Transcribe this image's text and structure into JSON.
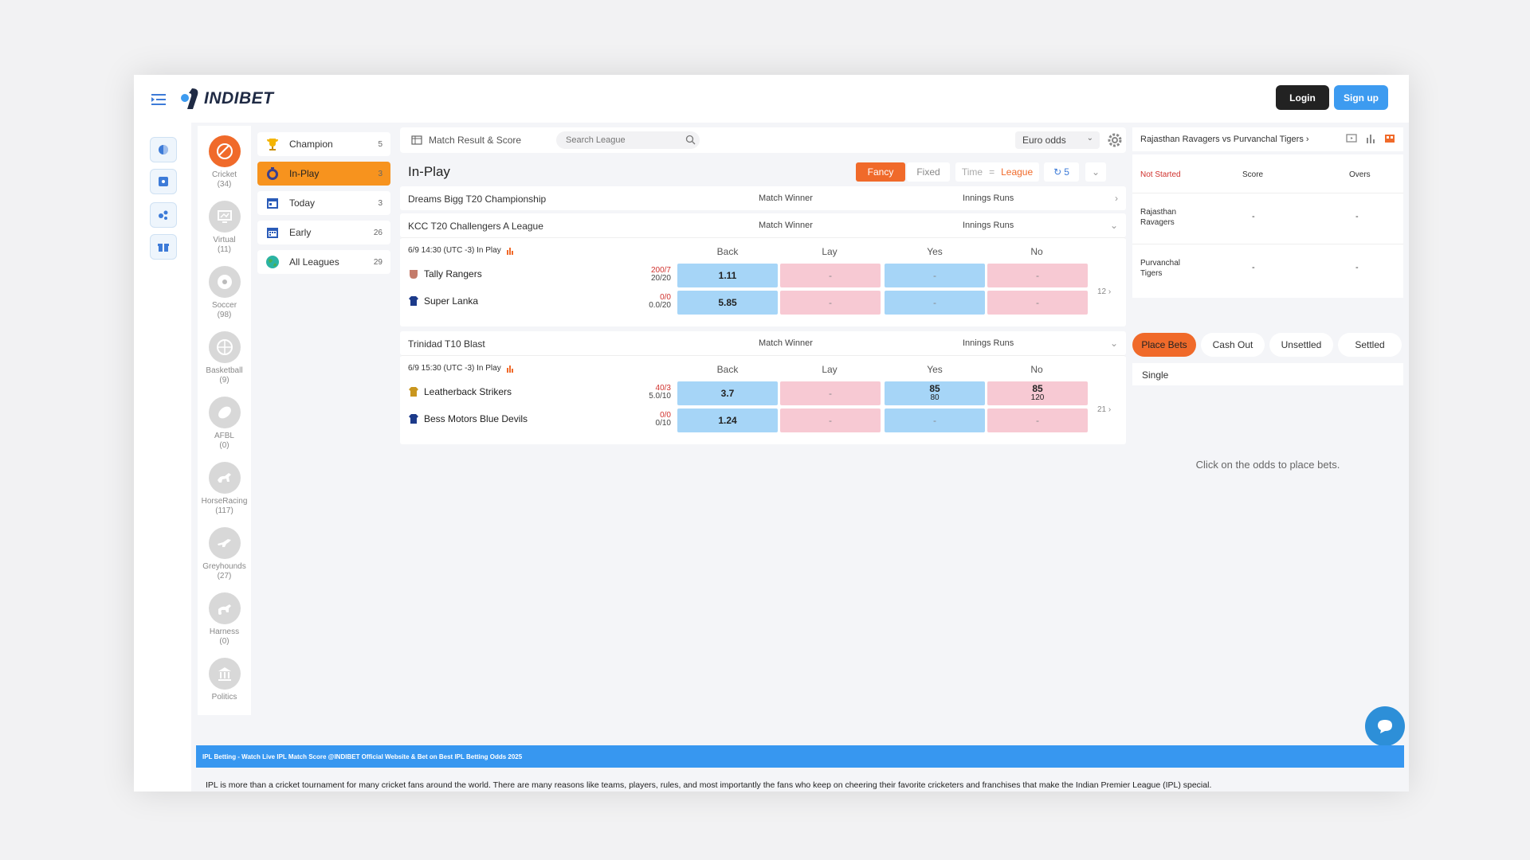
{
  "brand": {
    "name": "INDIBET"
  },
  "header": {
    "login_label": "Login",
    "signup_label": "Sign up"
  },
  "colors": {
    "accent": "#f06a2a",
    "primary": "#3d9bf0",
    "back": "#a6d5f7",
    "lay": "#f7c9d3"
  },
  "sports": [
    {
      "label": "Cricket",
      "count": "(34)",
      "icon": "cricket-ball-icon"
    },
    {
      "label": "Virtual",
      "count": "(11)",
      "icon": "monitor-icon"
    },
    {
      "label": "Soccer",
      "count": "(98)",
      "icon": "soccer-ball-icon"
    },
    {
      "label": "Basketball",
      "count": "(9)",
      "icon": "basketball-icon"
    },
    {
      "label": "AFBL",
      "count": "(0)",
      "icon": "football-icon"
    },
    {
      "label": "HorseRacing",
      "count": "(117)",
      "icon": "horse-icon"
    },
    {
      "label": "Greyhounds",
      "count": "(27)",
      "icon": "greyhound-icon"
    },
    {
      "label": "Harness",
      "count": "(0)",
      "icon": "harness-icon"
    },
    {
      "label": "Politics",
      "count": "",
      "icon": "politics-icon"
    }
  ],
  "categories": [
    {
      "label": "Champion",
      "count": "5",
      "icon": "trophy-icon"
    },
    {
      "label": "In-Play",
      "count": "3",
      "icon": "stopwatch-icon"
    },
    {
      "label": "Today",
      "count": "3",
      "icon": "calendar-today-icon"
    },
    {
      "label": "Early",
      "count": "26",
      "icon": "calendar-icon"
    },
    {
      "label": "All Leagues",
      "count": "29",
      "icon": "globe-icon"
    }
  ],
  "filter": {
    "market_label": "Match Result & Score",
    "search_placeholder": "Search League",
    "odds_format": "Euro odds"
  },
  "inplay": {
    "title": "In-Play",
    "fancy": "Fancy",
    "fixed": "Fixed",
    "time": "Time",
    "league": "League",
    "refresh_count": "5",
    "col_match_winner": "Match Winner",
    "col_innings_runs": "Innings Runs",
    "col_back": "Back",
    "col_lay": "Lay",
    "col_yes": "Yes",
    "col_no": "No"
  },
  "leagues": [
    {
      "name": "Dreams Bigg T20 Championship"
    },
    {
      "name": "KCC T20 Challengers A League"
    },
    {
      "name": "Trinidad T10 Blast"
    }
  ],
  "matches": [
    {
      "time": "6/9 14:30 (UTC -3) In Play",
      "more": "12",
      "teams": [
        {
          "name": "Tally Rangers",
          "score_top": "200/7",
          "score_bottom": "20/20",
          "back": "1.11",
          "lay": "-",
          "yes": "-",
          "yes_sub": "",
          "no": "-",
          "no_sub": ""
        },
        {
          "name": "Super Lanka",
          "score_top": "0/0",
          "score_bottom": "0.0/20",
          "back": "5.85",
          "lay": "-",
          "yes": "-",
          "yes_sub": "",
          "no": "-",
          "no_sub": ""
        }
      ]
    },
    {
      "time": "6/9 15:30 (UTC -3) In Play",
      "more": "21",
      "teams": [
        {
          "name": "Leatherback Strikers",
          "score_top": "40/3",
          "score_bottom": "5.0/10",
          "back": "3.7",
          "lay": "-",
          "yes": "85",
          "yes_sub": "80",
          "no": "85",
          "no_sub": "120"
        },
        {
          "name": "Bess Motors Blue Devils",
          "score_top": "0/0",
          "score_bottom": "0/10",
          "back": "1.24",
          "lay": "-",
          "yes": "-",
          "yes_sub": "",
          "no": "-",
          "no_sub": ""
        }
      ]
    }
  ],
  "right": {
    "match_title": "Rajasthan Ravagers vs Purvanchal Tigers",
    "status": "Not Started",
    "col_score": "Score",
    "col_overs": "Overs",
    "team1": "Rajasthan Ravagers",
    "team2": "Purvanchal Tigers",
    "dash": "-",
    "tabs": [
      "Place Bets",
      "Cash Out",
      "Unsettled",
      "Settled"
    ],
    "single": "Single",
    "hint": "Click on the odds to place bets."
  },
  "footer": {
    "banner": "IPL Betting - Watch Live IPL Match Score @INDIBET Official Website & Bet on Best IPL Betting Odds 2025",
    "text": "IPL is more than a cricket tournament for many cricket fans around the world. There are many reasons like teams, players, rules, and most importantly the fans who keep on cheering their favorite cricketers and franchises that make the Indian Premier League (IPL) special."
  }
}
